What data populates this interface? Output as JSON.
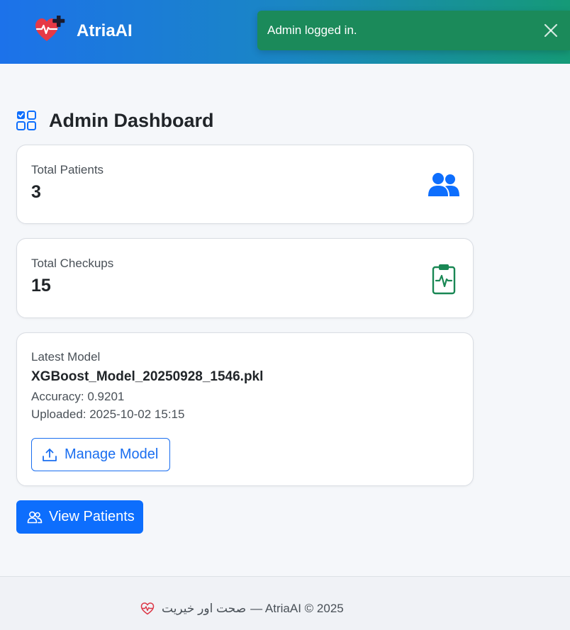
{
  "navbar": {
    "brand_name": "AtriaAI",
    "logo_icon": "heart-pulse-plus-icon",
    "gradient_colors": [
      "#1c72ea",
      "#159a77"
    ]
  },
  "toast": {
    "message": "Admin logged in.",
    "close_icon": "close-icon",
    "color": "#1b8a5a"
  },
  "page": {
    "title": "Admin Dashboard",
    "title_icon": "grid-check-icon"
  },
  "stats": {
    "patients": {
      "label": "Total Patients",
      "value": "3",
      "icon": "people-icon"
    },
    "checkups": {
      "label": "Total Checkups",
      "value": "15",
      "icon": "clipboard-pulse-icon"
    }
  },
  "model": {
    "label": "Latest Model",
    "name": "XGBoost_Model_20250928_1546.pkl",
    "accuracy_text": "Accuracy: 0.9201",
    "uploaded_text": "Uploaded: 2025-10-02 15:15",
    "manage_button": {
      "label": "Manage Model",
      "icon": "upload-icon"
    }
  },
  "view_patients_button": {
    "label": "View Patients",
    "icon": "people-outline-icon"
  },
  "footer": {
    "icon": "heart-pulse-icon",
    "arabic_text": "صحت اور خیریت",
    "rest_text": "— AtriaAI © 2025"
  },
  "colors": {
    "primary": "#0d6efd",
    "success": "#198754",
    "heart": "#e63946"
  }
}
